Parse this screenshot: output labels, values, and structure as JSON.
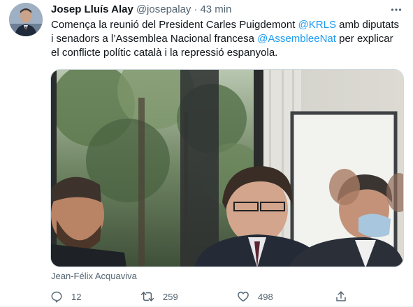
{
  "tweet": {
    "author": {
      "display_name": "Josep Lluís Alay",
      "handle": "@josepalay",
      "separator": "·",
      "time": "43 min"
    },
    "text": {
      "part1": "Comença la reunió del President Carles Puigdemont ",
      "mention1": "@KRLS",
      "part2": " amb diputats i senadors a l’Assemblea Nacional francesa ",
      "mention2": "@AssembleeNat",
      "part3": " per explicar el conflicte polític català i la repressió espanyola."
    },
    "media": {
      "credit": "Jean-Félix Acquaviva"
    },
    "actions": {
      "reply_count": "12",
      "retweet_count": "259",
      "like_count": "498"
    },
    "icons": {
      "more": "more-dots-icon",
      "reply": "reply-icon",
      "retweet": "retweet-icon",
      "like": "heart-icon",
      "share": "share-icon"
    },
    "colors": {
      "link": "#1d9bf0",
      "secondary_text": "#536471",
      "primary_text": "#0f1419"
    }
  }
}
